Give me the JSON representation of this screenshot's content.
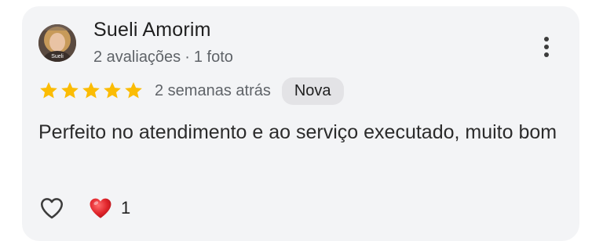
{
  "review": {
    "author_name": "Sueli Amorim",
    "avatar_caption": "Sueli",
    "reviews_count": "2 avaliações",
    "separator": "·",
    "photos_count": "1 foto",
    "rating": 5,
    "rating_max": 5,
    "time_ago": "2 semanas atrás",
    "badge": "Nova",
    "text": "Perfeito no atendimento e ao serviço executado, muito bom",
    "reaction_count": "1"
  },
  "icons": {
    "star": "star-icon",
    "more": "more-vert-icon",
    "like": "heart-outline-icon",
    "reaction": "red-heart-icon"
  },
  "colors": {
    "card_background": "#f3f4f6",
    "star": "#fbbc04",
    "badge_background": "#e3e3e6",
    "secondary_text": "#5f6368",
    "reaction_heart": "#e0242a"
  }
}
